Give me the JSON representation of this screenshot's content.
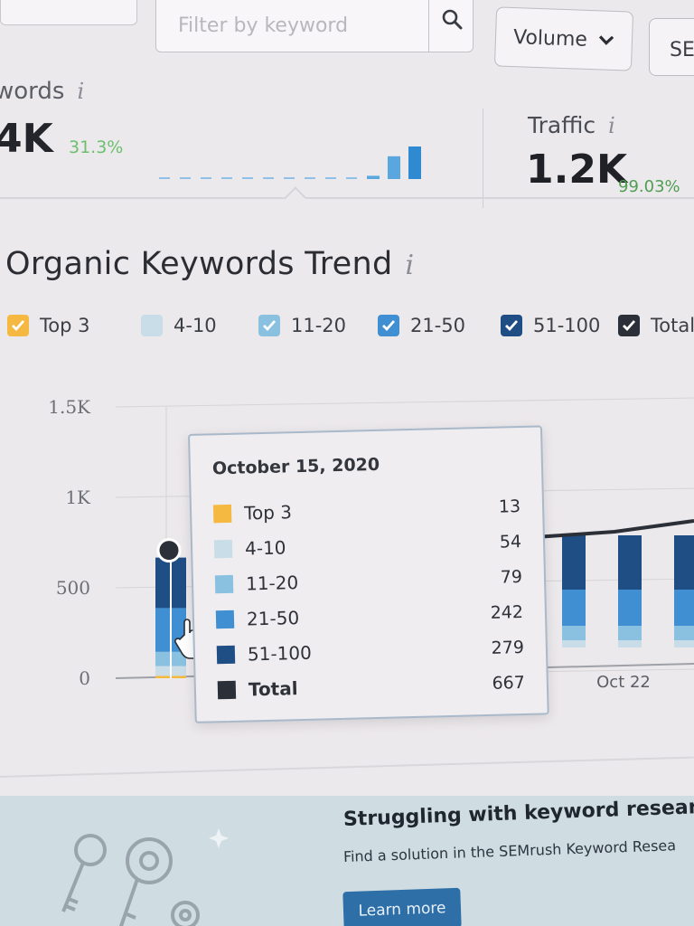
{
  "toolbar": {
    "filter_placeholder": "Filter by keyword",
    "volume_label": "Volume",
    "sem_label": "SE"
  },
  "metrics": {
    "keywords": {
      "label": "words",
      "value": "4K",
      "change": "31.3%"
    },
    "traffic": {
      "label": "Traffic",
      "value": "1.2K",
      "change": "99.03%"
    },
    "info_glyph": "i",
    "sparkline_heights": [
      0.02,
      0.02,
      0.02,
      0.02,
      0.02,
      0.02,
      0.02,
      0.02,
      0.02,
      0.02,
      0.1,
      0.7,
      1.0
    ]
  },
  "trend": {
    "title": "Organic Keywords Trend",
    "legend": [
      {
        "label": "Top 3",
        "color": "#f5b942",
        "checked": true
      },
      {
        "label": "4-10",
        "color": "#c9dde8",
        "checked": false
      },
      {
        "label": "11-20",
        "color": "#8ac0e0",
        "checked": true
      },
      {
        "label": "21-50",
        "color": "#3f8fd2",
        "checked": true
      },
      {
        "label": "51-100",
        "color": "#1f4e85",
        "checked": true
      },
      {
        "label": "Total",
        "color": "#2b3038",
        "checked": true
      }
    ]
  },
  "chart_data": {
    "type": "bar",
    "yticks": [
      "1.5K",
      "1K",
      "500",
      "0"
    ],
    "ylim": [
      0,
      1500
    ],
    "x_labels": [
      "Oct 22"
    ],
    "x_fragment": "0",
    "bars": [
      {
        "top3": 13,
        "r4_10": 54,
        "r11_20": 79,
        "r21_50": 242,
        "r51_100": 279,
        "total": 667
      }
    ],
    "total_line_right": 860
  },
  "tooltip": {
    "date": "October 15, 2020",
    "rows": [
      {
        "label": "Top 3",
        "value": "13",
        "color": "#f5b942"
      },
      {
        "label": "4-10",
        "value": "54",
        "color": "#c9dde8"
      },
      {
        "label": "11-20",
        "value": "79",
        "color": "#8ac0e0"
      },
      {
        "label": "21-50",
        "value": "242",
        "color": "#3f8fd2"
      },
      {
        "label": "51-100",
        "value": "279",
        "color": "#1f4e85"
      },
      {
        "label": "Total",
        "value": "667",
        "color": "#2b3038"
      }
    ]
  },
  "banner": {
    "title": "Struggling with keyword researc",
    "text": "Find a solution in the SEMrush Keyword Resea",
    "button": "Learn more"
  }
}
